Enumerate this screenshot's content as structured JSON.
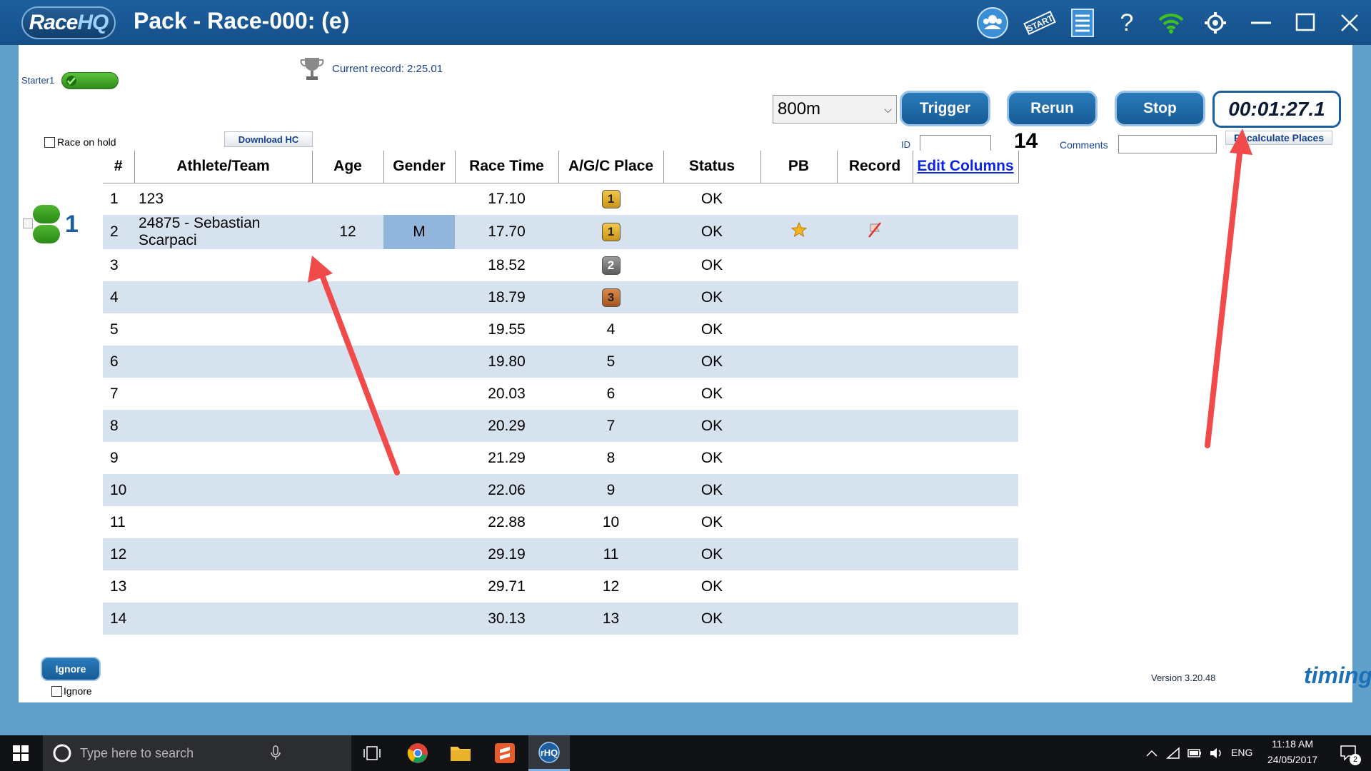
{
  "app": {
    "logo_race": "Race",
    "logo_hq": "HQ",
    "title": "Pack - Race-000: (e)"
  },
  "titlebar_icons": [
    "users-icon",
    "start-icon",
    "list-icon",
    "help-icon",
    "wifi-icon",
    "gear-icon",
    "minimize-icon",
    "maximize-icon",
    "close-icon"
  ],
  "toolbar": {
    "starter_label": "Starter1",
    "current_record": "Current record: 2:25.01",
    "race_on_hold": "Race on hold",
    "download_hc": "Download HC",
    "distance": "800m",
    "trigger": "Trigger",
    "rerun": "Rerun",
    "stop": "Stop",
    "timer": "00:01:27.1",
    "recalculate": "Recalculate Places",
    "id_label": "ID",
    "id_value": "",
    "count": "14",
    "comments_label": "Comments",
    "comments_value": ""
  },
  "heat": {
    "number": "1"
  },
  "table": {
    "headers": {
      "num": "#",
      "athlete": "Athlete/Team",
      "age": "Age",
      "gender": "Gender",
      "race_time": "Race Time",
      "place": "A/G/C Place",
      "status": "Status",
      "pb": "PB",
      "record": "Record",
      "edit": "Edit Columns"
    },
    "rows": [
      {
        "num": "1",
        "athlete": "123",
        "age": "",
        "gender": "",
        "time": "17.10",
        "place": "1",
        "badge": "gold",
        "status": "OK",
        "pb": false,
        "record": false
      },
      {
        "num": "2",
        "athlete": "24875 - Sebastian Scarpaci",
        "age": "12",
        "gender": "M",
        "time": "17.70",
        "place": "1",
        "badge": "gold",
        "status": "OK",
        "pb": true,
        "record": true
      },
      {
        "num": "3",
        "athlete": "",
        "age": "",
        "gender": "",
        "time": "18.52",
        "place": "2",
        "badge": "silver",
        "status": "OK",
        "pb": false,
        "record": false
      },
      {
        "num": "4",
        "athlete": "",
        "age": "",
        "gender": "",
        "time": "18.79",
        "place": "3",
        "badge": "bronze",
        "status": "OK",
        "pb": false,
        "record": false
      },
      {
        "num": "5",
        "athlete": "",
        "age": "",
        "gender": "",
        "time": "19.55",
        "place": "4",
        "badge": "",
        "status": "OK",
        "pb": false,
        "record": false
      },
      {
        "num": "6",
        "athlete": "",
        "age": "",
        "gender": "",
        "time": "19.80",
        "place": "5",
        "badge": "",
        "status": "OK",
        "pb": false,
        "record": false
      },
      {
        "num": "7",
        "athlete": "",
        "age": "",
        "gender": "",
        "time": "20.03",
        "place": "6",
        "badge": "",
        "status": "OK",
        "pb": false,
        "record": false
      },
      {
        "num": "8",
        "athlete": "",
        "age": "",
        "gender": "",
        "time": "20.29",
        "place": "7",
        "badge": "",
        "status": "OK",
        "pb": false,
        "record": false
      },
      {
        "num": "9",
        "athlete": "",
        "age": "",
        "gender": "",
        "time": "21.29",
        "place": "8",
        "badge": "",
        "status": "OK",
        "pb": false,
        "record": false
      },
      {
        "num": "10",
        "athlete": "",
        "age": "",
        "gender": "",
        "time": "22.06",
        "place": "9",
        "badge": "",
        "status": "OK",
        "pb": false,
        "record": false
      },
      {
        "num": "11",
        "athlete": "",
        "age": "",
        "gender": "",
        "time": "22.88",
        "place": "10",
        "badge": "",
        "status": "OK",
        "pb": false,
        "record": false
      },
      {
        "num": "12",
        "athlete": "",
        "age": "",
        "gender": "",
        "time": "29.19",
        "place": "11",
        "badge": "",
        "status": "OK",
        "pb": false,
        "record": false
      },
      {
        "num": "13",
        "athlete": "",
        "age": "",
        "gender": "",
        "time": "29.71",
        "place": "12",
        "badge": "",
        "status": "OK",
        "pb": false,
        "record": false
      },
      {
        "num": "14",
        "athlete": "",
        "age": "",
        "gender": "",
        "time": "30.13",
        "place": "13",
        "badge": "",
        "status": "OK",
        "pb": false,
        "record": false
      }
    ]
  },
  "footer": {
    "ignore_button": "Ignore",
    "ignore_checkbox": "Ignore",
    "version": "Version 3.20.48",
    "brand": "timing"
  },
  "taskbar": {
    "search_placeholder": "Type here to search",
    "language": "ENG",
    "time": "11:18 AM",
    "date": "24/05/2017",
    "notification_count": "2"
  },
  "colors": {
    "titlebar": "#15508a",
    "accent": "#1d5f9e",
    "row_alt": "#d6e2ee",
    "gender_cell": "#92b5dc",
    "annotation_arrow": "#f04a4a"
  }
}
